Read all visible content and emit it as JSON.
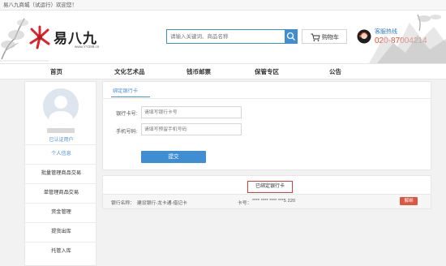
{
  "topbar": {
    "welcome": "易八九商城（试运行）欢迎您！"
  },
  "header": {
    "logo_text": "易八九",
    "logo_sub": "www.YY289.cn",
    "search_placeholder": "请输入关键词、商品名称",
    "cart_label": "购物车",
    "hotline_label": "客服热线",
    "hotline_number": "020-87004214"
  },
  "nav": {
    "items": [
      "首页",
      "文化艺术品",
      "钱币邮票",
      "保管专区",
      "公告"
    ]
  },
  "sidebar": {
    "verified": "已认证用户",
    "items": [
      "个人信息",
      "批量管理商品交易",
      "单管理商品交易",
      "资金管理",
      "提货出库",
      "托管入库"
    ]
  },
  "bind_form": {
    "tab": "绑定银行卡",
    "card_label": "银行卡号:",
    "card_placeholder": "请填写银行卡号",
    "phone_label": "手机号码:",
    "phone_placeholder": "请填写预留手机号码",
    "submit": "提交"
  },
  "bound": {
    "title": "已绑定银行卡",
    "name_label": "银行名称：",
    "name_value": "建设银行-龙卡通-借记卡",
    "card_label": "卡号：",
    "card_value": "**** **** **** ***5 220",
    "unbind": "解绑"
  },
  "colors": {
    "accent": "#3f8ed4",
    "hotline": "#e24b2b",
    "danger": "#e0553d",
    "highlight_border": "#e03a3a"
  }
}
